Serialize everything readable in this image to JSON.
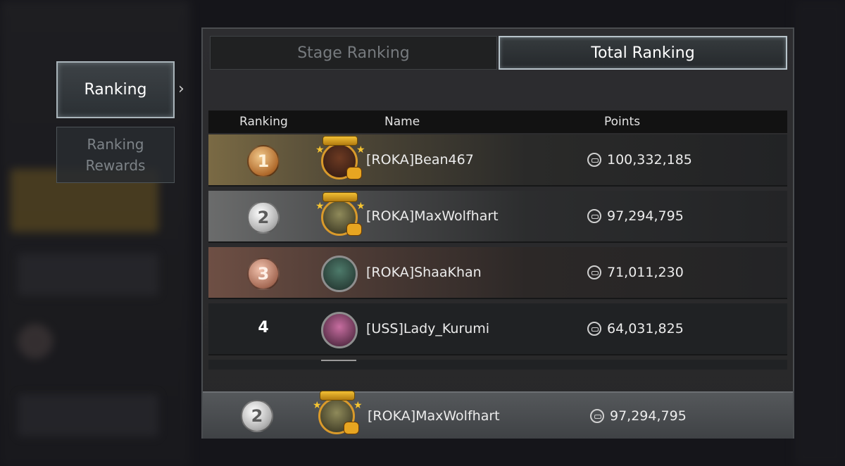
{
  "side_menu": {
    "items": [
      {
        "label": "Ranking",
        "active": true
      },
      {
        "label": "Ranking Rewards",
        "active": false
      }
    ]
  },
  "tabs": [
    {
      "label": "Stage Ranking",
      "active": false
    },
    {
      "label": "Total Ranking",
      "active": true
    }
  ],
  "columns": {
    "ranking": "Ranking",
    "name": "Name",
    "points": "Points"
  },
  "rows": [
    {
      "rank": "1",
      "medal": "gold",
      "name": "[ROKA]Bean467",
      "points": "100,332,185",
      "frame": "hunter-frame"
    },
    {
      "rank": "2",
      "medal": "silver",
      "name": "[ROKA]MaxWolfhart",
      "points": "97,294,795",
      "frame": "hunter-frame"
    },
    {
      "rank": "3",
      "medal": "bronze",
      "name": "[ROKA]ShaaKhan",
      "points": "71,011,230",
      "frame": "plain-frame"
    },
    {
      "rank": "4",
      "medal": "none",
      "name": "[USS]Lady_Kurumi",
      "points": "64,031,825",
      "frame": "plain-frame"
    }
  ],
  "my_rank": {
    "rank": "2",
    "medal": "silver",
    "name": "[ROKA]MaxWolfhart",
    "points": "97,294,795"
  },
  "icons": {
    "points": "points-medal-icon",
    "chevron": "chevron-right-icon"
  },
  "colors": {
    "gold": "#b06a2c",
    "silver": "#b3b3b3",
    "bronze": "#a56a55",
    "frame_gold": "#d99a2b"
  }
}
